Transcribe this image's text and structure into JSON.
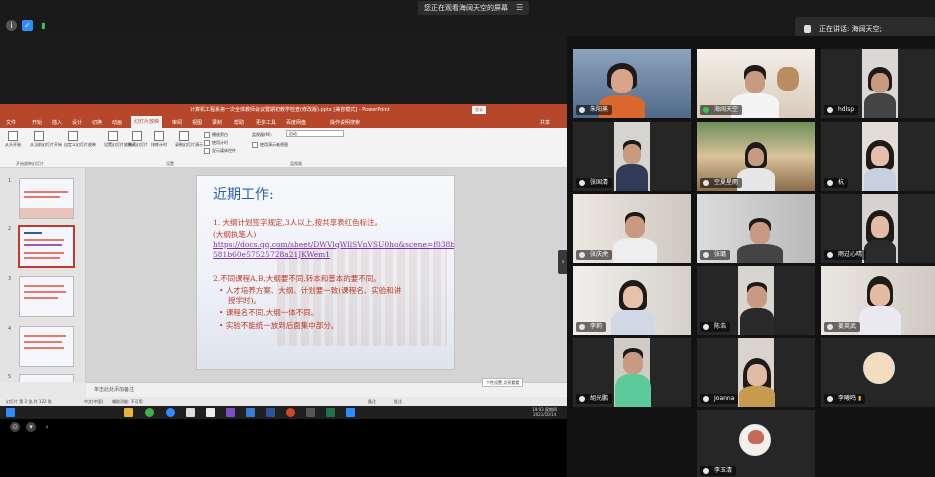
{
  "screen_notice": {
    "text": "您正在观看海阔天空的屏幕",
    "menu": "☰"
  },
  "speaking": {
    "label": "正在讲话:",
    "name": "海阔天空;"
  },
  "ppt": {
    "title": "计算机工程系第一次全体教师会议暨期初教学检查(修改版).pptx [兼容模式] - PowerPoint",
    "login": "登录",
    "tabs": [
      "文件",
      "开始",
      "插入",
      "设计",
      "切换",
      "动画",
      "幻灯片放映",
      "审阅",
      "视图",
      "录制",
      "帮助",
      "更多工具",
      "百度网盘",
      "操作说明搜索"
    ],
    "active_tab": "幻灯片放映",
    "share": "共享",
    "ribbon": {
      "btn_from_start": "从头开始",
      "btn_from_current": "从当前幻灯片开始",
      "btn_custom": "自定义幻灯片放映",
      "btn_setup": "设置幻灯片放映",
      "btn_hide": "隐藏幻灯片",
      "btn_rehearse": "排练计时",
      "btn_record": "录制幻灯片演示",
      "chk_narration": "播放旁白",
      "chk_timing": "使用计时",
      "chk_media": "显示媒体控件",
      "monitor_label": "监视器(M):",
      "monitor_value": "自动",
      "chk_presenter": "使用演示者视图",
      "group_start": "开始放映幻灯片",
      "group_setup": "设置",
      "group_monitor": "监视器"
    },
    "slide": {
      "title": "近期工作:",
      "item1": "1. 大纲计划签字规定,3人以上,按共享表红色标注。",
      "item1b": "(大纲执笔人)",
      "link1": "https://docs.qq.com/sheet/DWVlqWllSVnVSU0ho&scene=f038b6",
      "link2": "581b60e57525728a21JKWem1",
      "item2": "2.不同课程A,B,大纲要不同,转本和普本的要不同。",
      "bullets": [
        "人才培养方案、大纲、计划要一致(课程名、实验和讲",
        "授学时)。",
        "课程名不同,大纲一体不同。",
        "实验不能统一放到后面集中部分。"
      ]
    },
    "slide_numbers": [
      "1",
      "2",
      "3",
      "4",
      "5"
    ],
    "notes": "单击此处添加备注",
    "tooltip": "个性设置   点亮看看",
    "status_left": "幻灯片 第 2 张,共 122 张",
    "status_lang": "中文(中国)",
    "status_access": "辅助功能: 不可用",
    "status_notes": "备注",
    "status_comments": "批注",
    "tray_time": "19:03 星期四",
    "tray_date": "2021/10/14"
  },
  "participants": [
    {
      "name": "朱阳蒸",
      "talking": false
    },
    {
      "name": "海阔天空",
      "talking": true
    },
    {
      "name": "hdlsp",
      "talking": false
    },
    {
      "name": "张国清",
      "talking": false
    },
    {
      "name": "空夏星雨",
      "talking": false
    },
    {
      "name": "杭",
      "talking": false
    },
    {
      "name": "张庆虎",
      "talking": false
    },
    {
      "name": "张璐",
      "talking": false
    },
    {
      "name": "雨过心晴",
      "talking": false
    },
    {
      "name": "李莉",
      "talking": false
    },
    {
      "name": "陈浩",
      "talking": false
    },
    {
      "name": "姜英武",
      "talking": false
    },
    {
      "name": "胡光鹏",
      "talking": false
    },
    {
      "name": "Joanna",
      "talking": false
    },
    {
      "name": "李曦鸣",
      "talking": false
    },
    {
      "name": "李玉清",
      "talking": false
    }
  ],
  "colors": {
    "ppt_red": "#b7472a",
    "active_speaker": "#33c44b",
    "link": "#7b2fb6"
  }
}
